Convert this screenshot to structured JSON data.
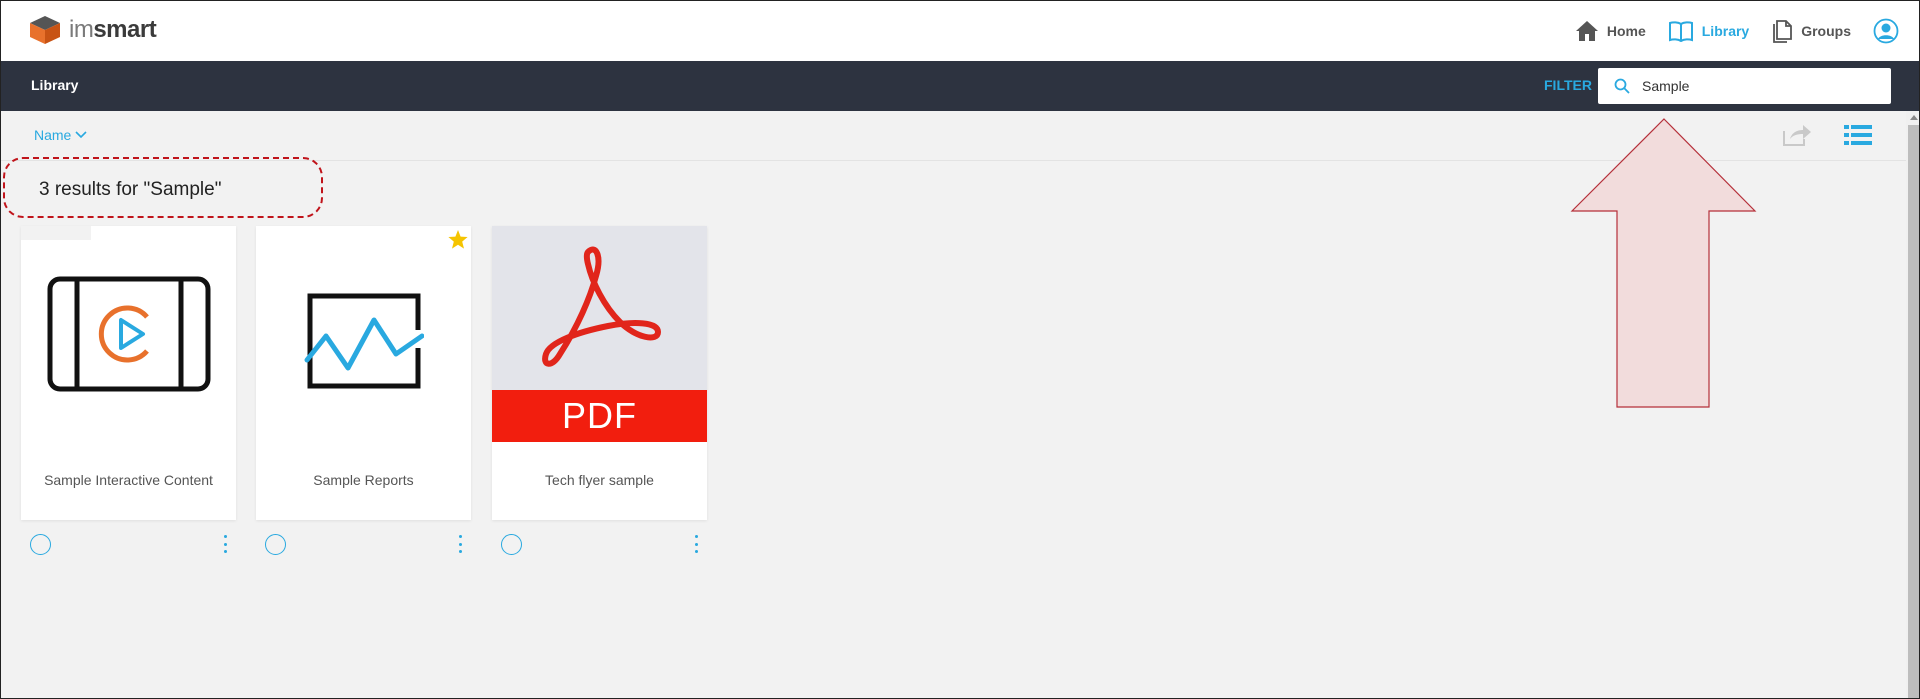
{
  "header": {
    "logo_text_light": "im",
    "logo_text_bold": "smart",
    "nav": [
      {
        "label": "Home",
        "icon": "home-icon"
      },
      {
        "label": "Library",
        "icon": "book-icon",
        "active": true
      },
      {
        "label": "Groups",
        "icon": "documents-icon"
      }
    ],
    "avatar_icon": "user-icon"
  },
  "library_bar": {
    "title": "Library",
    "filter_label": "FILTER",
    "search_value": "Sample"
  },
  "toolbar": {
    "sort_label": "Name"
  },
  "results": {
    "summary": "3 results for \"Sample\""
  },
  "items": [
    {
      "label": "Sample Interactive Content",
      "type": "interactive",
      "starred": false
    },
    {
      "label": "Sample Reports",
      "type": "report",
      "starred": true
    },
    {
      "label": "Tech flyer sample",
      "type": "pdf",
      "starred": false,
      "badge": "PDF"
    }
  ],
  "colors": {
    "accent": "#29a9e0",
    "dark_bar": "#2d3340",
    "pdf_red": "#f21e0e",
    "star": "#f5c400",
    "annotation": "#c0141b"
  }
}
